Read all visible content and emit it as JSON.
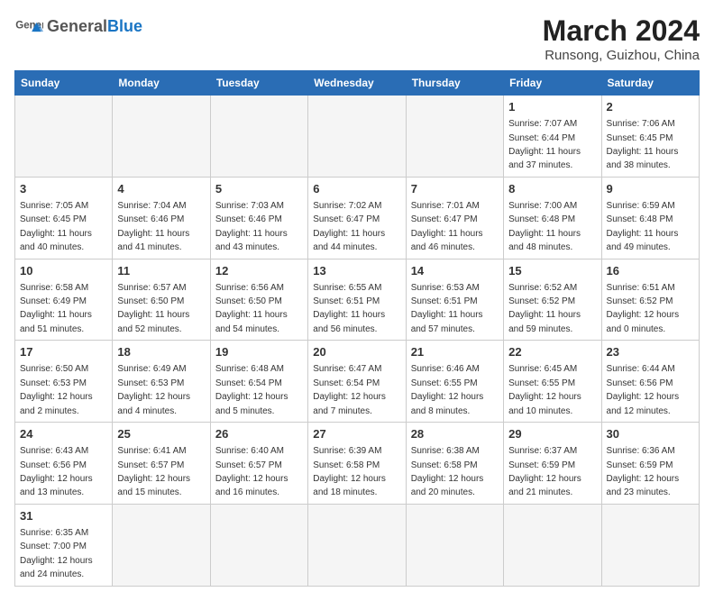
{
  "header": {
    "logo_general": "General",
    "logo_blue": "Blue",
    "month_title": "March 2024",
    "location": "Runsong, Guizhou, China"
  },
  "days_of_week": [
    "Sunday",
    "Monday",
    "Tuesday",
    "Wednesday",
    "Thursday",
    "Friday",
    "Saturday"
  ],
  "weeks": [
    [
      {
        "day": "",
        "info": ""
      },
      {
        "day": "",
        "info": ""
      },
      {
        "day": "",
        "info": ""
      },
      {
        "day": "",
        "info": ""
      },
      {
        "day": "",
        "info": ""
      },
      {
        "day": "1",
        "info": "Sunrise: 7:07 AM\nSunset: 6:44 PM\nDaylight: 11 hours and 37 minutes."
      },
      {
        "day": "2",
        "info": "Sunrise: 7:06 AM\nSunset: 6:45 PM\nDaylight: 11 hours and 38 minutes."
      }
    ],
    [
      {
        "day": "3",
        "info": "Sunrise: 7:05 AM\nSunset: 6:45 PM\nDaylight: 11 hours and 40 minutes."
      },
      {
        "day": "4",
        "info": "Sunrise: 7:04 AM\nSunset: 6:46 PM\nDaylight: 11 hours and 41 minutes."
      },
      {
        "day": "5",
        "info": "Sunrise: 7:03 AM\nSunset: 6:46 PM\nDaylight: 11 hours and 43 minutes."
      },
      {
        "day": "6",
        "info": "Sunrise: 7:02 AM\nSunset: 6:47 PM\nDaylight: 11 hours and 44 minutes."
      },
      {
        "day": "7",
        "info": "Sunrise: 7:01 AM\nSunset: 6:47 PM\nDaylight: 11 hours and 46 minutes."
      },
      {
        "day": "8",
        "info": "Sunrise: 7:00 AM\nSunset: 6:48 PM\nDaylight: 11 hours and 48 minutes."
      },
      {
        "day": "9",
        "info": "Sunrise: 6:59 AM\nSunset: 6:48 PM\nDaylight: 11 hours and 49 minutes."
      }
    ],
    [
      {
        "day": "10",
        "info": "Sunrise: 6:58 AM\nSunset: 6:49 PM\nDaylight: 11 hours and 51 minutes."
      },
      {
        "day": "11",
        "info": "Sunrise: 6:57 AM\nSunset: 6:50 PM\nDaylight: 11 hours and 52 minutes."
      },
      {
        "day": "12",
        "info": "Sunrise: 6:56 AM\nSunset: 6:50 PM\nDaylight: 11 hours and 54 minutes."
      },
      {
        "day": "13",
        "info": "Sunrise: 6:55 AM\nSunset: 6:51 PM\nDaylight: 11 hours and 56 minutes."
      },
      {
        "day": "14",
        "info": "Sunrise: 6:53 AM\nSunset: 6:51 PM\nDaylight: 11 hours and 57 minutes."
      },
      {
        "day": "15",
        "info": "Sunrise: 6:52 AM\nSunset: 6:52 PM\nDaylight: 11 hours and 59 minutes."
      },
      {
        "day": "16",
        "info": "Sunrise: 6:51 AM\nSunset: 6:52 PM\nDaylight: 12 hours and 0 minutes."
      }
    ],
    [
      {
        "day": "17",
        "info": "Sunrise: 6:50 AM\nSunset: 6:53 PM\nDaylight: 12 hours and 2 minutes."
      },
      {
        "day": "18",
        "info": "Sunrise: 6:49 AM\nSunset: 6:53 PM\nDaylight: 12 hours and 4 minutes."
      },
      {
        "day": "19",
        "info": "Sunrise: 6:48 AM\nSunset: 6:54 PM\nDaylight: 12 hours and 5 minutes."
      },
      {
        "day": "20",
        "info": "Sunrise: 6:47 AM\nSunset: 6:54 PM\nDaylight: 12 hours and 7 minutes."
      },
      {
        "day": "21",
        "info": "Sunrise: 6:46 AM\nSunset: 6:55 PM\nDaylight: 12 hours and 8 minutes."
      },
      {
        "day": "22",
        "info": "Sunrise: 6:45 AM\nSunset: 6:55 PM\nDaylight: 12 hours and 10 minutes."
      },
      {
        "day": "23",
        "info": "Sunrise: 6:44 AM\nSunset: 6:56 PM\nDaylight: 12 hours and 12 minutes."
      }
    ],
    [
      {
        "day": "24",
        "info": "Sunrise: 6:43 AM\nSunset: 6:56 PM\nDaylight: 12 hours and 13 minutes."
      },
      {
        "day": "25",
        "info": "Sunrise: 6:41 AM\nSunset: 6:57 PM\nDaylight: 12 hours and 15 minutes."
      },
      {
        "day": "26",
        "info": "Sunrise: 6:40 AM\nSunset: 6:57 PM\nDaylight: 12 hours and 16 minutes."
      },
      {
        "day": "27",
        "info": "Sunrise: 6:39 AM\nSunset: 6:58 PM\nDaylight: 12 hours and 18 minutes."
      },
      {
        "day": "28",
        "info": "Sunrise: 6:38 AM\nSunset: 6:58 PM\nDaylight: 12 hours and 20 minutes."
      },
      {
        "day": "29",
        "info": "Sunrise: 6:37 AM\nSunset: 6:59 PM\nDaylight: 12 hours and 21 minutes."
      },
      {
        "day": "30",
        "info": "Sunrise: 6:36 AM\nSunset: 6:59 PM\nDaylight: 12 hours and 23 minutes."
      }
    ],
    [
      {
        "day": "31",
        "info": "Sunrise: 6:35 AM\nSunset: 7:00 PM\nDaylight: 12 hours and 24 minutes."
      },
      {
        "day": "",
        "info": ""
      },
      {
        "day": "",
        "info": ""
      },
      {
        "day": "",
        "info": ""
      },
      {
        "day": "",
        "info": ""
      },
      {
        "day": "",
        "info": ""
      },
      {
        "day": "",
        "info": ""
      }
    ]
  ]
}
